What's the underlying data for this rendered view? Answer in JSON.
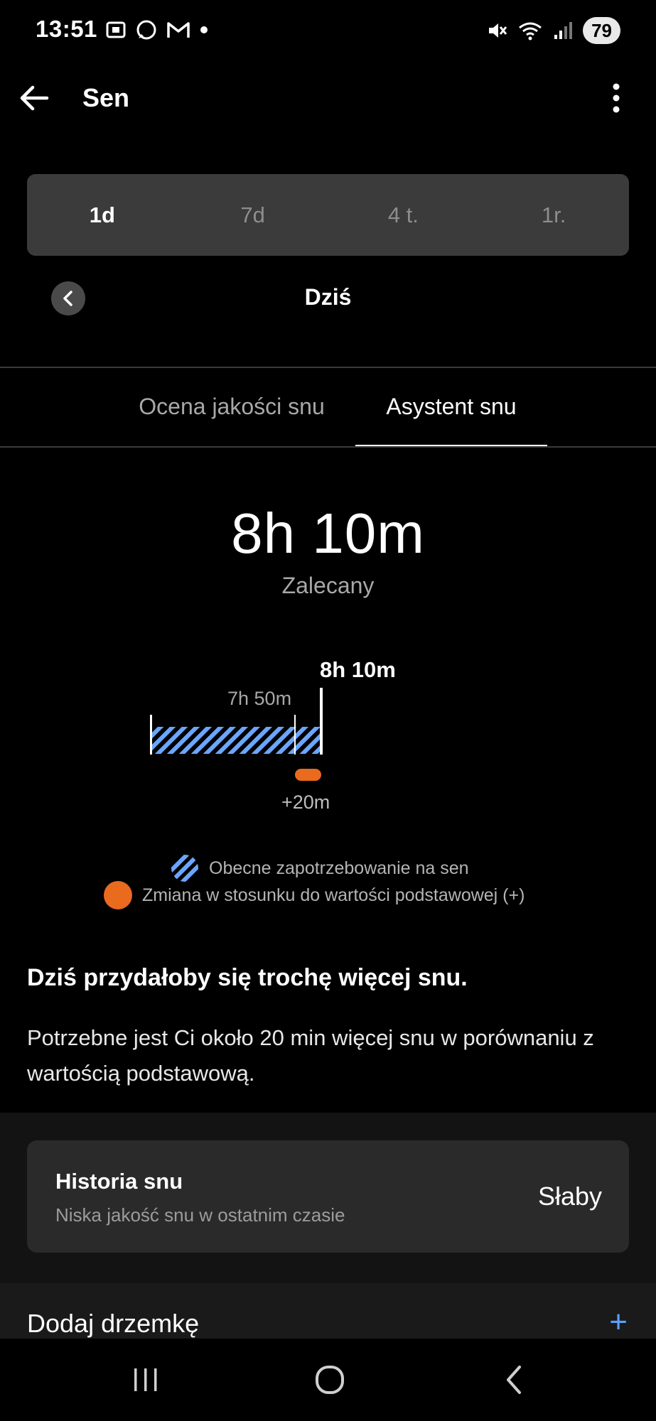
{
  "status_bar": {
    "time": "13:51",
    "battery": "79"
  },
  "header": {
    "title": "Sen"
  },
  "period_selector": {
    "options": [
      "1d",
      "7d",
      "4 t.",
      "1r."
    ],
    "selected": "1d"
  },
  "date_nav": {
    "label": "Dziś"
  },
  "tabs": [
    {
      "label": "Ocena jakości snu",
      "active": false
    },
    {
      "label": "Asystent snu",
      "active": true
    }
  ],
  "recommendation": {
    "value": "8h 10m",
    "label": "Zalecany"
  },
  "graph": {
    "target_label": "8h 10m",
    "current_label": "7h 50m",
    "delta_label": "+20m",
    "current_minutes": 470,
    "target_minutes": 490,
    "colors": {
      "hatch": "#6aa6ff",
      "change": "#ea6a1e"
    }
  },
  "legend": {
    "current_need": "Obecne zapotrzebowanie na sen",
    "change_from_baseline": "Zmiana w stosunku do wartości podstawowej (+)"
  },
  "message": {
    "title": "Dziś przydałoby się trochę więcej snu.",
    "body": "Potrzebne jest Ci około 20 min więcej snu w porównaniu z wartością podstawową."
  },
  "history_card": {
    "title": "Historia snu",
    "subtitle": "Niska jakość snu w ostatnim czasie",
    "value": "Słaby"
  },
  "nap": {
    "label": "Dodaj drzemkę",
    "add_icon": "+"
  }
}
